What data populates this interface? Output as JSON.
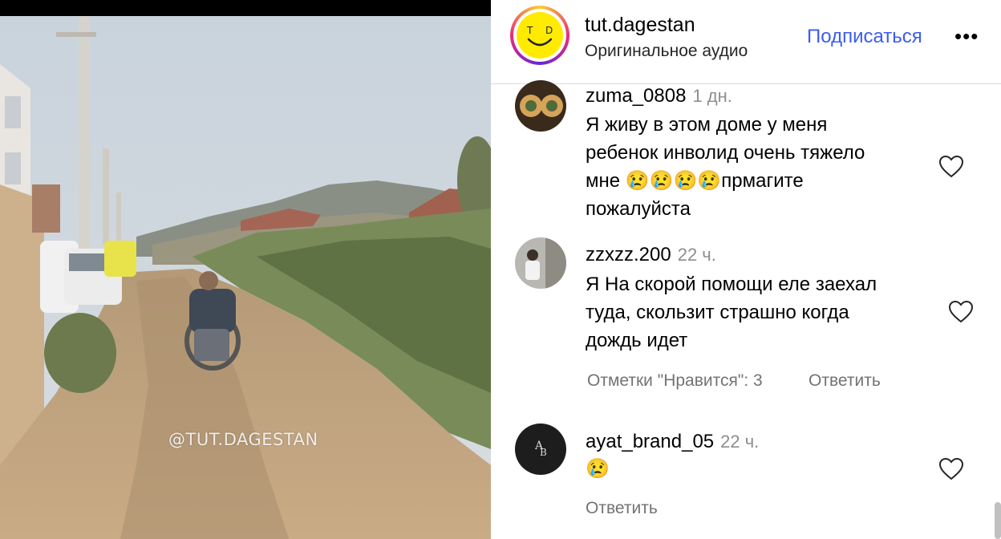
{
  "video": {
    "watermark": "@TUT.DAGESTAN"
  },
  "header": {
    "username": "tut.dagestan",
    "subtitle": "Оригинальное аудио",
    "follow_label": "Подписаться",
    "more_glyph": "•••",
    "avatar_icon": "smiley-face-icon"
  },
  "comments": [
    {
      "username": "zuma_0808",
      "time": "1 дн.",
      "lines": [
        "Я живу в этом доме у меня",
        "ребенок инволид очень тяжело",
        "мне 😢😢😢😢прмагите",
        "пожалуйста"
      ]
    },
    {
      "username": "zzxzz.200",
      "time": "22 ч.",
      "lines": [
        "Я На скорой помощи еле заехал",
        "туда, скользит страшно когда",
        "дождь идет"
      ],
      "likes_label": "Отметки \"Нравится\": 3",
      "reply_label": "Ответить"
    },
    {
      "username": "ayat_brand_05",
      "time": "22 ч.",
      "lines": [
        "😢"
      ],
      "reply_label": "Ответить"
    }
  ],
  "colors": {
    "accent": "#3b5cf0",
    "muted": "#737373",
    "avatar_yellow": "#ffeb00"
  }
}
